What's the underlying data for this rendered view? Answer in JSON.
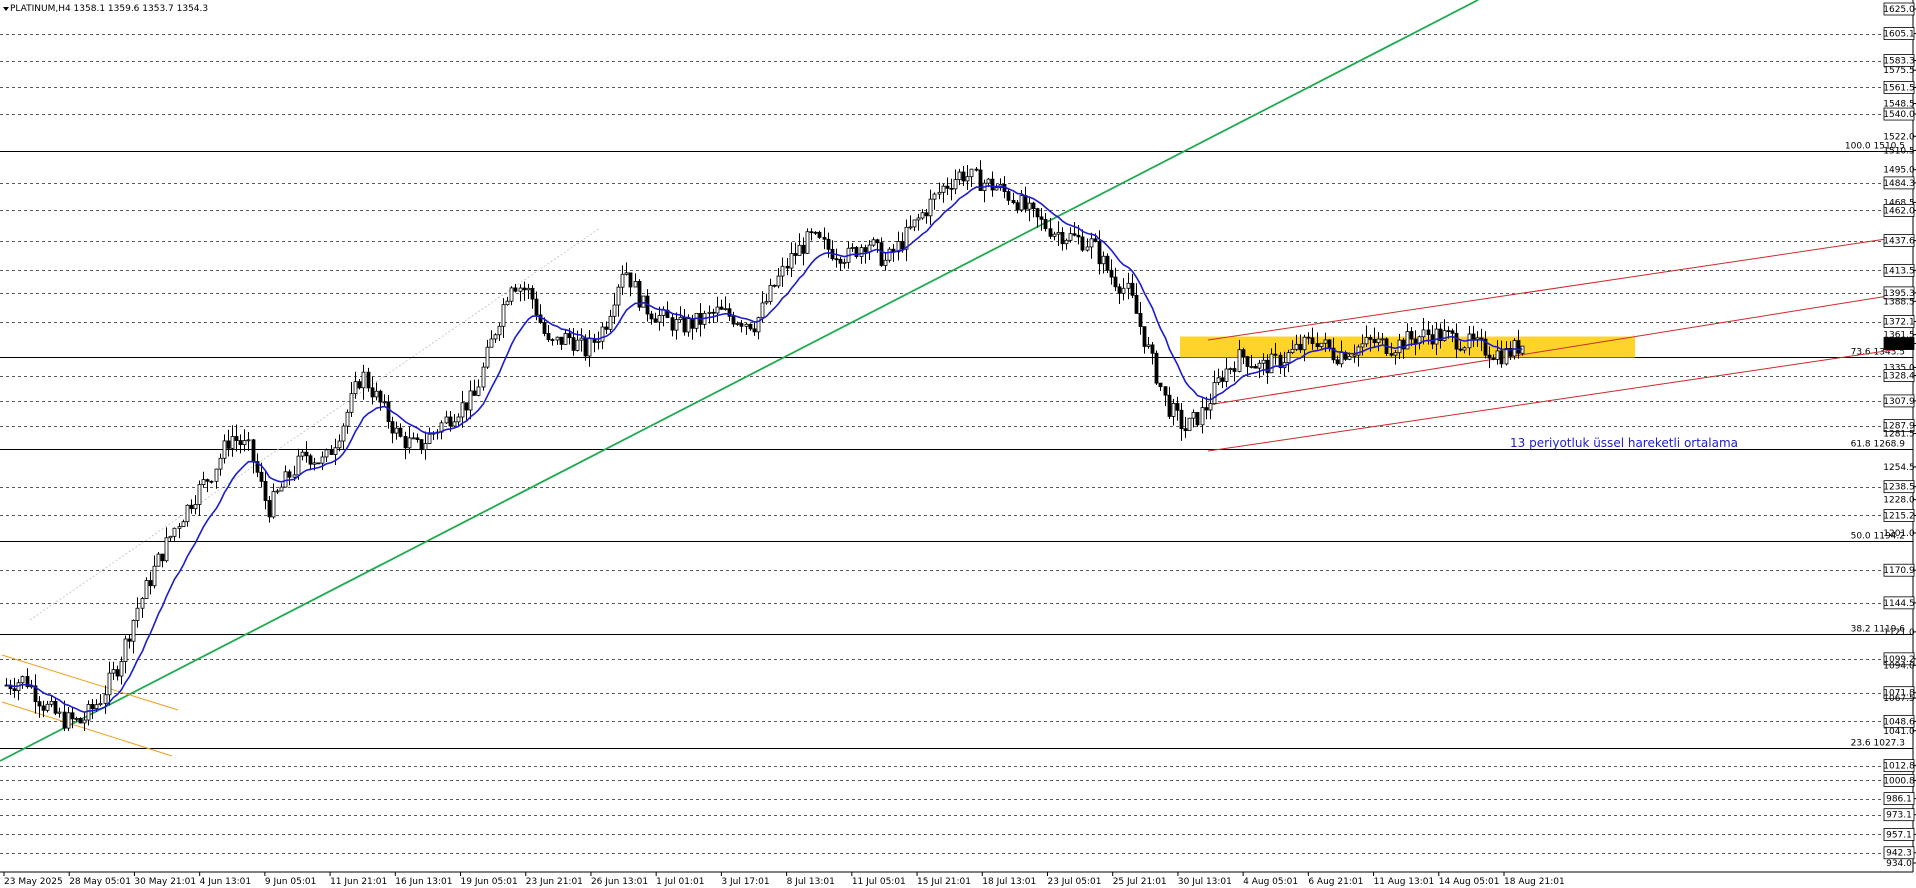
{
  "chart_data": {
    "type": "candlestick",
    "symbol_header": "PLATINUM,H4  1358.1 1359.6 1353.7 1354.3",
    "ylim": [
      934.0,
      1625.0
    ],
    "x_labels": [
      "23 May 2025",
      "28 May 05:01",
      "30 May 21:01",
      "4 Jun 13:01",
      "9 Jun 05:01",
      "11 Jun 21:01",
      "16 Jun 13:01",
      "19 Jun 05:01",
      "23 Jun 21:01",
      "26 Jun 13:01",
      "1 Jul 01:01",
      "3 Jul 17:01",
      "8 Jul 13:01",
      "11 Jul 05:01",
      "15 Jul 21:01",
      "18 Jul 13:01",
      "23 Jul 05:01",
      "25 Jul 21:01",
      "30 Jul 13:01",
      "4 Aug 05:01",
      "6 Aug 21:01",
      "11 Aug 13:01",
      "14 Aug 05:01",
      "18 Aug 21:01"
    ],
    "y_ticks": [
      1625.0,
      1605.1,
      1583.3,
      1575.5,
      1561.5,
      1548.5,
      1540.0,
      1522.0,
      1510.5,
      1495.0,
      1484.3,
      1468.5,
      1462.0,
      1437.6,
      1413.5,
      1395.3,
      1388.5,
      1372.1,
      1361.5,
      1354.3,
      1335.0,
      1328.4,
      1307.9,
      1287.9,
      1281.5,
      1254.5,
      1238.5,
      1228.0,
      1215.2,
      1201.0,
      1170.9,
      1144.5,
      1121.0,
      1099.2,
      1094.0,
      1071.8,
      1067.5,
      1048.6,
      1041.0,
      1012.8,
      1000.8,
      986.1,
      973.1,
      957.1,
      942.3,
      934.0
    ],
    "boxed_ticks": [
      1625.0,
      1605.1,
      1583.3,
      1561.5,
      1540.0,
      1484.3,
      1462.0,
      1437.6,
      1413.5,
      1395.3,
      1372.1,
      1354.3,
      1328.4,
      1307.9,
      1287.9,
      1238.5,
      1215.2,
      1170.9,
      1144.5,
      1099.2,
      1071.8,
      1048.6,
      1012.8,
      1000.8,
      986.1,
      973.1,
      957.1,
      942.3
    ],
    "horizontal_levels": [
      1605.1,
      1583.3,
      1561.5,
      1540.0,
      1484.3,
      1462.0,
      1437.6,
      1413.5,
      1395.3,
      1372.1,
      1328.4,
      1307.9,
      1287.9,
      1238.5,
      1215.2,
      1170.9,
      1144.5,
      1099.2,
      1071.8,
      1048.6,
      1012.8,
      1000.8,
      986.1,
      973.1,
      957.1,
      942.3
    ],
    "fibonacci": [
      {
        "label": "100.0 1510.5",
        "value": 1510.5
      },
      {
        "label": "73.6 1343.5",
        "value": 1343.5
      },
      {
        "label": "61.8 1268.9",
        "value": 1268.9
      },
      {
        "label": "50.0 1194.2",
        "value": 1194.2
      },
      {
        "label": "38.2 1119.6",
        "value": 1119.6
      },
      {
        "label": "23.6 1027.3",
        "value": 1027.3
      }
    ],
    "current_price": 1354.3,
    "support_zone": [
      1343.0,
      1360.0
    ],
    "ema_period": 13,
    "annotation": "13 periyotluk üssel hareketli ortalama",
    "price_path": [
      1078,
      1083,
      1062,
      1050,
      1048,
      1066,
      1095,
      1140,
      1175,
      1205,
      1230,
      1250,
      1280,
      1268,
      1220,
      1245,
      1265,
      1258,
      1290,
      1330,
      1305,
      1278,
      1270,
      1285,
      1300,
      1310,
      1360,
      1405,
      1395,
      1352,
      1360,
      1348,
      1370,
      1418,
      1385,
      1375,
      1368,
      1372,
      1380,
      1375,
      1370,
      1400,
      1425,
      1440,
      1430,
      1425,
      1438,
      1420,
      1440,
      1460,
      1480,
      1492,
      1486,
      1480,
      1470,
      1455,
      1445,
      1440,
      1435,
      1410,
      1395,
      1350,
      1305,
      1285,
      1300,
      1330,
      1345,
      1335,
      1340,
      1350,
      1358,
      1345,
      1350,
      1356,
      1352,
      1358,
      1362,
      1360,
      1355,
      1350,
      1345,
      1354
    ],
    "colors": {
      "ema": "#1c1cd0",
      "uptrend_line": "#1faa4f",
      "channel": "#cc2a2a",
      "early_channel": "#f0a020",
      "support_zone": "#ffd21f",
      "candle": "#000000"
    }
  }
}
